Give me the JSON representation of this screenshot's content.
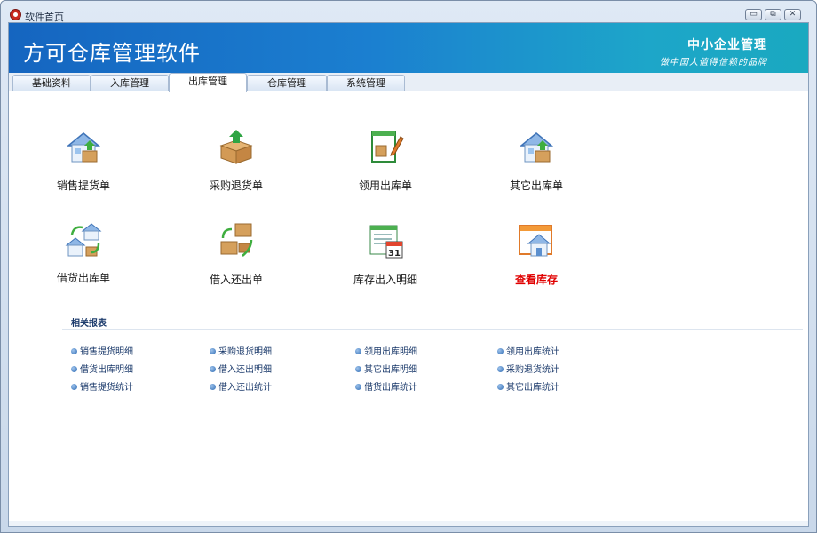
{
  "window": {
    "title": "软件首页",
    "buttons": {
      "minimize": "▭",
      "restore": "⧉",
      "close": "✕"
    }
  },
  "banner": {
    "title": "方可仓库管理软件",
    "slogan_main": "中小企业管理",
    "slogan_sub": "做中国人值得信赖的品牌"
  },
  "tabs": [
    {
      "label": "基础资料",
      "active": false
    },
    {
      "label": "入库管理",
      "active": false
    },
    {
      "label": "出库管理",
      "active": true
    },
    {
      "label": "仓库管理",
      "active": false
    },
    {
      "label": "系统管理",
      "active": false
    }
  ],
  "functions": [
    {
      "label": "销售提货单",
      "icon": "house-box-icon"
    },
    {
      "label": "采购退货单",
      "icon": "box-return-icon"
    },
    {
      "label": "领用出库单",
      "icon": "form-edit-icon"
    },
    {
      "label": "其它出库单",
      "icon": "house-box-icon"
    },
    {
      "label": "借货出库单",
      "icon": "house-transfer-icon"
    },
    {
      "label": "借入还出单",
      "icon": "boxes-cycle-icon"
    },
    {
      "label": "库存出入明细",
      "icon": "calendar-list-icon"
    },
    {
      "label": "查看库存",
      "icon": "house-window-icon"
    }
  ],
  "reports": {
    "title": "相关报表",
    "links": [
      "销售提货明细",
      "采购退货明细",
      "领用出库明细",
      "领用出库统计",
      "借货出库明细",
      "借入还出明细",
      "其它出库明细",
      "采购退货统计",
      "销售提货统计",
      "借入还出统计",
      "借货出库统计",
      "其它出库统计"
    ]
  },
  "colors": {
    "banner_start": "#1565c0",
    "banner_end": "#1aa9c0",
    "highlight_label": "#e00000",
    "link": "#1b3a6b"
  }
}
